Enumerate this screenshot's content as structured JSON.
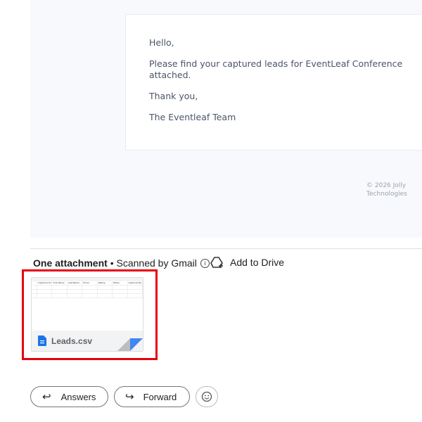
{
  "email": {
    "greeting": "Hello,",
    "body": "Please find your captured leads for EventLeaf Conference attached.",
    "thanks": "Thank you,",
    "signature": "The Eventleaf Team",
    "footer": "© 2026 Jolly Technologies"
  },
  "attachments": {
    "title": "One attachment",
    "scanned": " • Scanned by Gmail",
    "add_to_drive": "Add to Drive",
    "file": {
      "name": "Leads.csv",
      "preview_headers": [
        "Captured On",
        "First Name",
        "Last Name",
        "Email",
        "Rating",
        "Notes",
        "Captured By"
      ],
      "highlight_color": "#e8000b"
    }
  },
  "actions": {
    "reply_all": "Answers",
    "forward": "Forward",
    "emoji": "emoji-reaction-icon"
  }
}
